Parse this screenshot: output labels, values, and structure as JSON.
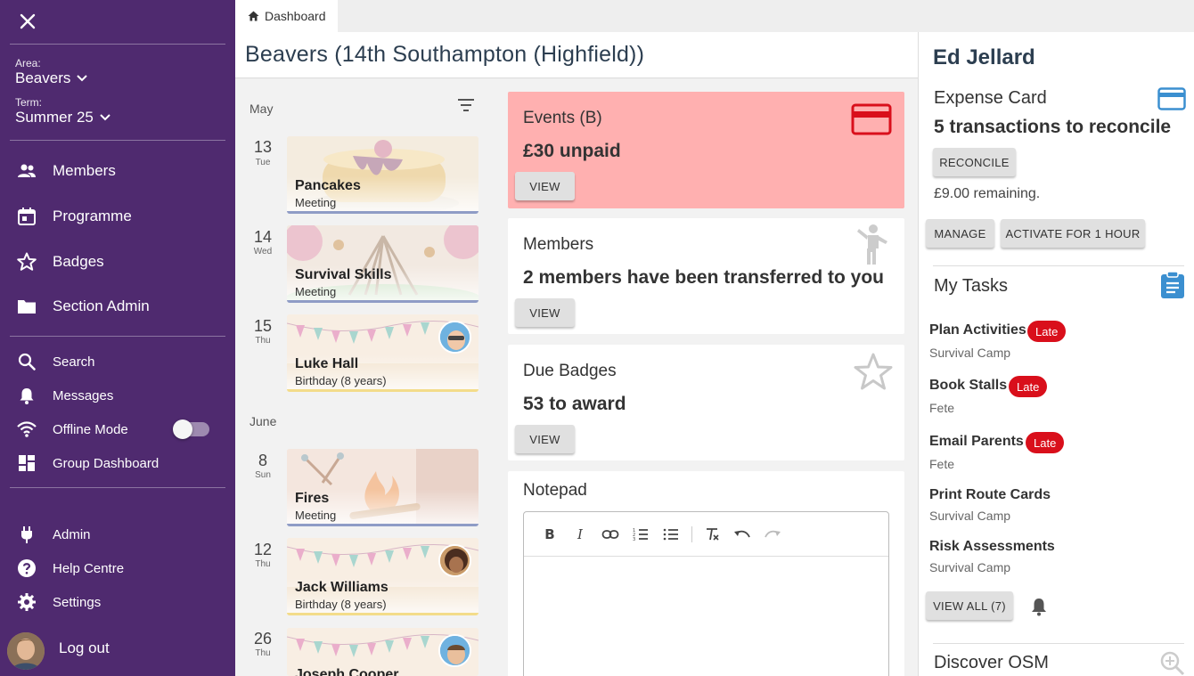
{
  "sidebar": {
    "area_label": "Area:",
    "area_value": "Beavers",
    "term_label": "Term:",
    "term_value": "Summer 25",
    "nav": [
      {
        "label": "Members",
        "icon": "people-icon"
      },
      {
        "label": "Programme",
        "icon": "calendar-icon"
      },
      {
        "label": "Badges",
        "icon": "star-icon"
      },
      {
        "label": "Section Admin",
        "icon": "folder-icon"
      }
    ],
    "tools": [
      {
        "label": "Search",
        "icon": "search-icon"
      },
      {
        "label": "Messages",
        "icon": "bell-icon"
      },
      {
        "label": "Offline Mode",
        "icon": "wifi-icon"
      },
      {
        "label": "Group Dashboard",
        "icon": "dashboard-icon"
      }
    ],
    "bottom": [
      {
        "label": "Admin",
        "icon": "plug-icon"
      },
      {
        "label": "Help Centre",
        "icon": "help-icon"
      },
      {
        "label": "Settings",
        "icon": "gear-icon"
      }
    ],
    "logout": "Log out",
    "offline_mode_on": false
  },
  "tabs": {
    "dashboard": "Dashboard"
  },
  "header": {
    "title": "Beavers (14th Southampton (Highfield))"
  },
  "programme": {
    "months": [
      "May",
      "June"
    ],
    "events": [
      {
        "day": "13",
        "dow": "Tue",
        "title": "Pancakes",
        "sub": "Meeting"
      },
      {
        "day": "14",
        "dow": "Wed",
        "title": "Survival Skills",
        "sub": "Meeting"
      },
      {
        "day": "15",
        "dow": "Thu",
        "title": "Luke Hall",
        "sub": "Birthday (8 years)"
      },
      {
        "day": "8",
        "dow": "Sun",
        "title": "Fires",
        "sub": "Meeting"
      },
      {
        "day": "12",
        "dow": "Thu",
        "title": "Jack Williams",
        "sub": "Birthday (8 years)"
      },
      {
        "day": "26",
        "dow": "Thu",
        "title": "Joseph Cooper",
        "sub": ""
      }
    ]
  },
  "cards": {
    "events": {
      "title": "Events (B)",
      "value": "£30 unpaid",
      "button": "VIEW",
      "bg": "#ffb0b0",
      "icon_color": "#d90f1b"
    },
    "members": {
      "title": "Members",
      "value": "2 members have been transferred to you",
      "button": "VIEW"
    },
    "badges": {
      "title": "Due Badges",
      "value": "53 to award",
      "button": "VIEW"
    },
    "notepad": {
      "title": "Notepad"
    }
  },
  "right": {
    "user": "Ed Jellard",
    "expense_title": "Expense Card",
    "expense_value": "5 transactions to reconcile",
    "reconcile": "RECONCILE",
    "remaining": "£9.00 remaining.",
    "manage": "MANAGE",
    "activate": "ACTIVATE FOR 1 HOUR",
    "tasks_title": "My Tasks",
    "late_label": "Late",
    "tasks": [
      {
        "name": "Plan Activities",
        "sub": "Survival Camp",
        "late": true
      },
      {
        "name": "Book Stalls",
        "sub": "Fete",
        "late": true
      },
      {
        "name": "Email Parents",
        "sub": "Fete",
        "late": true
      },
      {
        "name": "Print Route Cards",
        "sub": "Survival Camp",
        "late": false
      },
      {
        "name": "Risk Assessments",
        "sub": "Survival Camp",
        "late": false
      }
    ],
    "view_all": "VIEW ALL (7)",
    "discover": "Discover OSM",
    "accent": "#3b8fd0"
  }
}
